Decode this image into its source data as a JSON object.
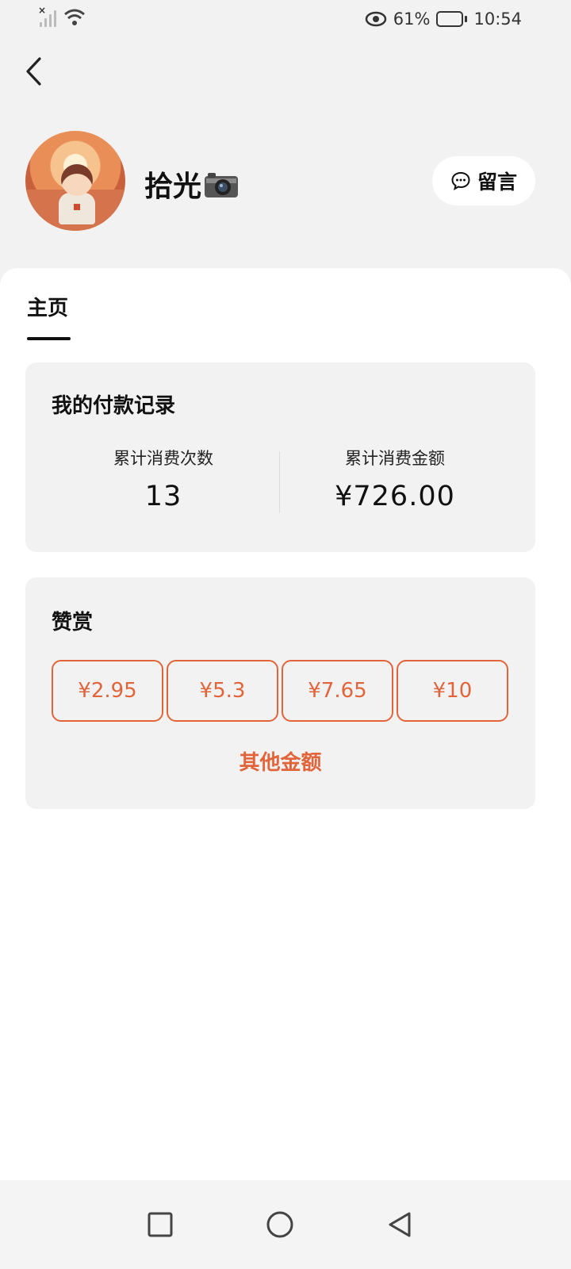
{
  "status_bar": {
    "battery_percent": "61%",
    "time": "10:54",
    "icons": [
      "signal-icon",
      "wifi-icon",
      "eye-icon",
      "battery-icon"
    ]
  },
  "header": {
    "back_icon": "chevron-left-icon",
    "profile_name": "拾光",
    "name_emoji_icon": "camera-icon",
    "message_button_label": "留言",
    "message_icon": "chat-bubble-icon"
  },
  "tabs": {
    "home_label": "主页"
  },
  "payment_record": {
    "title": "我的付款记录",
    "count_label": "累计消费次数",
    "count_value": "13",
    "amount_label": "累计消费金额",
    "amount_value": "¥726.00"
  },
  "tip": {
    "title": "赞赏",
    "amounts": [
      "¥2.95",
      "¥5.3",
      "¥7.65",
      "¥10"
    ],
    "other_amount_label": "其他金额"
  },
  "colors": {
    "accent": "#e2643a",
    "background": "#f2f2f2",
    "card": "#f2f2f2",
    "panel": "#ffffff"
  },
  "nav_bar": {
    "icons": [
      "recent-apps-icon",
      "home-icon",
      "back-icon"
    ]
  }
}
